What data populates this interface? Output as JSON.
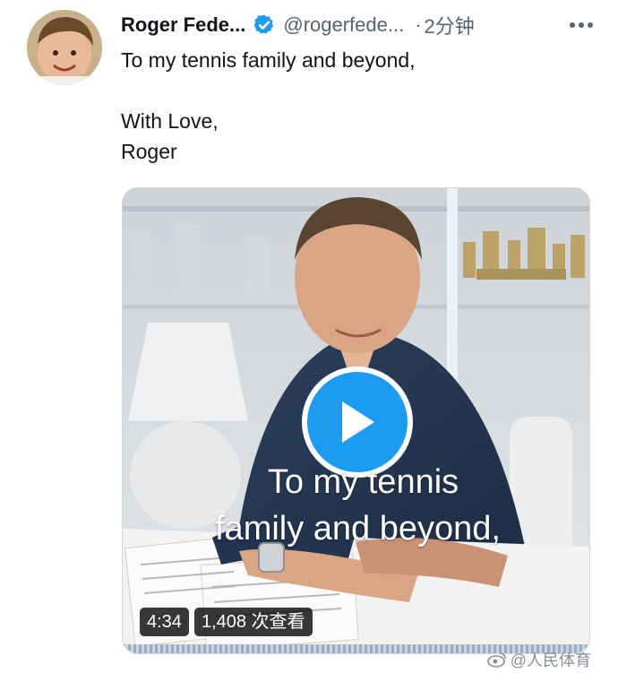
{
  "tweet": {
    "display_name": "Roger Fede...",
    "handle": "@rogerfede...",
    "separator": "·",
    "time": "2分钟",
    "text_lines": [
      "To my tennis family and beyond,",
      "",
      "With Love,",
      "Roger"
    ],
    "verified": true
  },
  "media": {
    "caption_line1": "To my tennis",
    "caption_line2": "family and beyond,",
    "duration": "4:34",
    "view_count": "1,408 次查看"
  },
  "watermark": {
    "text": "@人民体育"
  },
  "colors": {
    "accent": "#1d9bf0",
    "secondary_text": "#536471",
    "primary_text": "#0f1419"
  },
  "icons": {
    "verified": "verified-badge-icon",
    "more": "more-dots-icon",
    "play": "play-icon"
  }
}
